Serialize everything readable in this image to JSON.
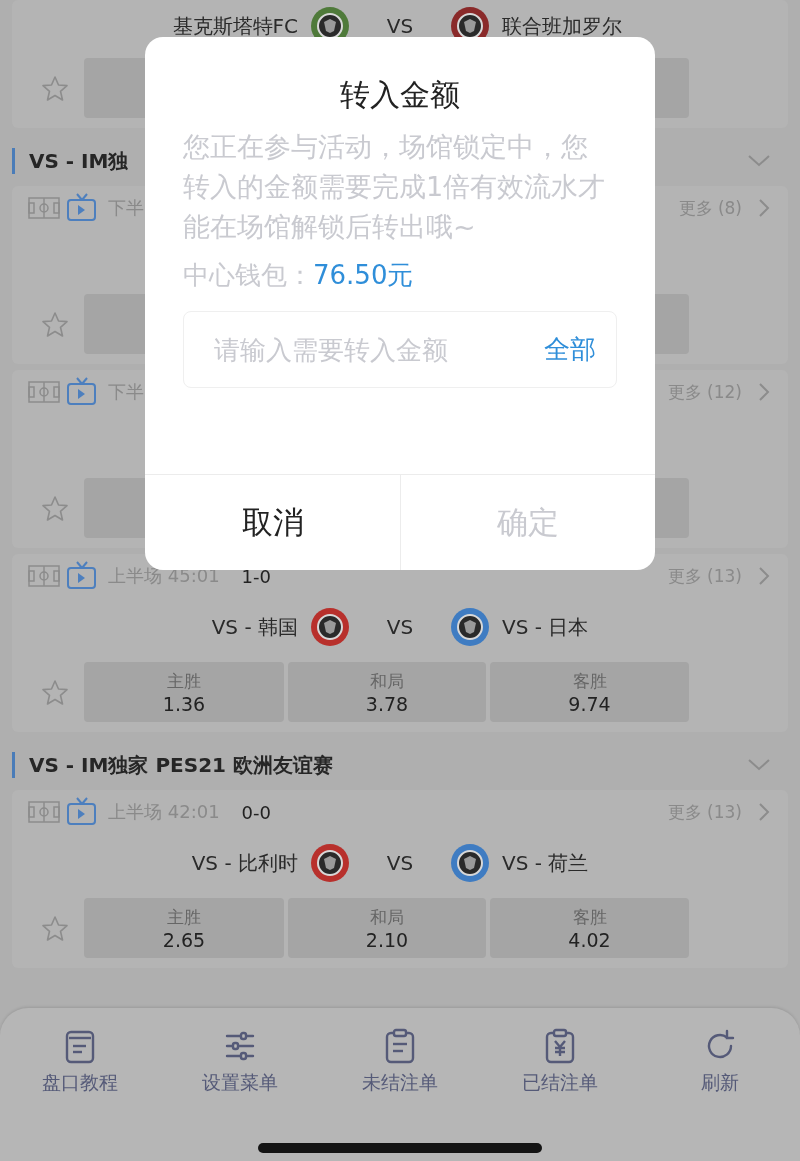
{
  "list": [
    {
      "kind": "match",
      "teams": {
        "home": {
          "name": "基克斯塔特FC",
          "color": "#4f7a3a"
        },
        "vs": "VS",
        "away": {
          "name": "联合班加罗尔",
          "color": "#8a2a2a"
        }
      },
      "odds": {
        "starred": false
      }
    },
    {
      "kind": "header",
      "title": "VS - IM独"
    },
    {
      "kind": "match",
      "meta": {
        "status": "下半",
        "more": "更多 (8)"
      },
      "odds": {
        "starred": false
      }
    },
    {
      "kind": "match",
      "meta": {
        "status": "下半",
        "more": "更多 (12)"
      },
      "odds": {
        "starred": false
      }
    },
    {
      "kind": "match",
      "meta": {
        "status": "上半场 45:01",
        "score": "1-0",
        "more": "更多 (13)"
      },
      "teams": {
        "home": {
          "name": "VS - 韩国",
          "color": "#b8302c"
        },
        "vs": "VS",
        "away": {
          "name": "VS - 日本",
          "color": "#3f7cc2"
        }
      },
      "odds": {
        "starred": false,
        "options": [
          {
            "label": "主胜",
            "value": "1.36"
          },
          {
            "label": "和局",
            "value": "3.78"
          },
          {
            "label": "客胜",
            "value": "9.74"
          }
        ]
      }
    },
    {
      "kind": "header",
      "title": "VS - IM独家 PES21 欧洲友谊赛"
    },
    {
      "kind": "match",
      "meta": {
        "status": "上半场 42:01",
        "score": "0-0",
        "more": "更多 (13)"
      },
      "teams": {
        "home": {
          "name": "VS - 比利时",
          "color": "#b8302c"
        },
        "vs": "VS",
        "away": {
          "name": "VS - 荷兰",
          "color": "#3f7cc2"
        }
      },
      "odds": {
        "starred": false,
        "options": [
          {
            "label": "主胜",
            "value": "2.65"
          },
          {
            "label": "和局",
            "value": "2.10"
          },
          {
            "label": "客胜",
            "value": "4.02"
          }
        ]
      }
    }
  ],
  "toolbar": [
    {
      "label": "盘口教程",
      "kind": "notebook"
    },
    {
      "label": "设置菜单",
      "kind": "sliders"
    },
    {
      "label": "未结注单",
      "kind": "clipboard"
    },
    {
      "label": "已结注单",
      "kind": "receipt"
    },
    {
      "label": "刷新",
      "kind": "refresh"
    }
  ],
  "dialog": {
    "title": "转入金额",
    "message": "您正在参与活动，场馆锁定中，您转入的金额需要完成1倍有效流水才能在场馆解锁后转出哦~",
    "wallet_label": "中心钱包：",
    "wallet_amount": "76.50元",
    "input": {
      "placeholder": "请输入需要转入金额",
      "action": "全部"
    },
    "buttons": [
      {
        "label": "取消",
        "disabled": false
      },
      {
        "label": "确定",
        "disabled": true
      }
    ]
  }
}
